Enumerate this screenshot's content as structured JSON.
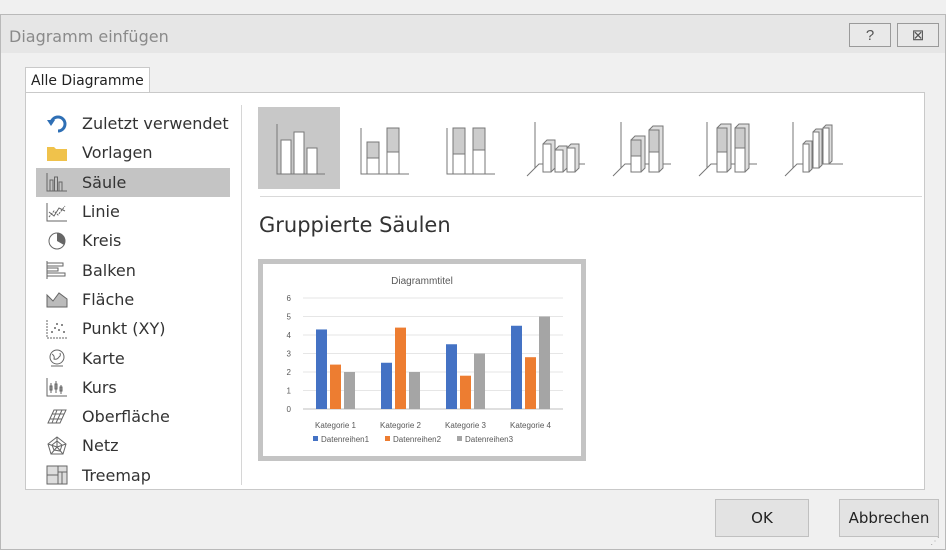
{
  "dialog": {
    "title": "Diagramm einfügen",
    "help_label": "?",
    "close_label": "⊠"
  },
  "tab": {
    "label": "Alle Diagramme"
  },
  "sidebar": {
    "items": [
      {
        "label": "Zuletzt verwendet",
        "icon": "undo-arrow-icon"
      },
      {
        "label": "Vorlagen",
        "icon": "folder-icon"
      },
      {
        "label": "Säule",
        "icon": "column-chart-icon",
        "selected": true
      },
      {
        "label": "Linie",
        "icon": "line-chart-icon"
      },
      {
        "label": "Kreis",
        "icon": "pie-chart-icon"
      },
      {
        "label": "Balken",
        "icon": "bar-chart-icon"
      },
      {
        "label": "Fläche",
        "icon": "area-chart-icon"
      },
      {
        "label": "Punkt (XY)",
        "icon": "scatter-chart-icon"
      },
      {
        "label": "Karte",
        "icon": "map-globe-icon"
      },
      {
        "label": "Kurs",
        "icon": "stock-chart-icon"
      },
      {
        "label": "Oberfläche",
        "icon": "surface-chart-icon"
      },
      {
        "label": "Netz",
        "icon": "radar-chart-icon"
      },
      {
        "label": "Treemap",
        "icon": "treemap-icon"
      }
    ]
  },
  "subtypes": {
    "selected_index": 0,
    "items": [
      {
        "icon": "clustered-column-icon"
      },
      {
        "icon": "stacked-column-icon"
      },
      {
        "icon": "100-stacked-column-icon"
      },
      {
        "icon": "3d-clustered-column-icon"
      },
      {
        "icon": "3d-stacked-column-icon"
      },
      {
        "icon": "3d-100-stacked-column-icon"
      },
      {
        "icon": "3d-column-icon"
      }
    ]
  },
  "main": {
    "heading": "Gruppierte Säulen"
  },
  "chart_data": {
    "type": "bar",
    "title": "Diagrammtitel",
    "categories": [
      "Kategorie 1",
      "Kategorie 2",
      "Kategorie 3",
      "Kategorie 4"
    ],
    "series": [
      {
        "name": "Datenreihen1",
        "values": [
          4.3,
          2.5,
          3.5,
          4.5
        ],
        "color": "#4472c4"
      },
      {
        "name": "Datenreihen2",
        "values": [
          2.4,
          4.4,
          1.8,
          2.8
        ],
        "color": "#ed7d31"
      },
      {
        "name": "Datenreihen3",
        "values": [
          2,
          2,
          3,
          5
        ],
        "color": "#a5a5a5"
      }
    ],
    "ylim": [
      0,
      6
    ],
    "yticks": [
      0,
      1,
      2,
      3,
      4,
      5,
      6
    ],
    "grid": true,
    "legend": "bottom"
  },
  "footer": {
    "ok_label": "OK",
    "cancel_label": "Abbrechen"
  }
}
